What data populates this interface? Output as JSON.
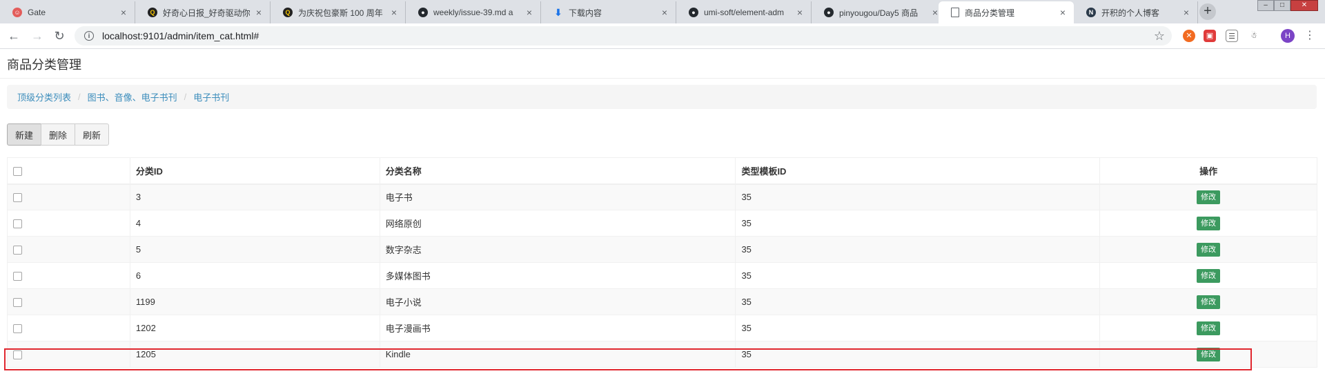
{
  "browser": {
    "tabs": [
      {
        "title": "Gate",
        "icon": "gate-favicon-icon",
        "color": "#e35d5b"
      },
      {
        "title": "好奇心日报_好奇驱动你",
        "icon": "q-favicon-icon",
        "color": "#222222"
      },
      {
        "title": "为庆祝包豪斯 100 周年",
        "icon": "q-favicon-icon",
        "color": "#222222"
      },
      {
        "title": "weekly/issue-39.md a",
        "icon": "github-icon",
        "color": "#24292e"
      },
      {
        "title": "下载内容",
        "icon": "download-icon",
        "color": "#1a73e8"
      },
      {
        "title": "umi-soft/element-adm",
        "icon": "github-icon",
        "color": "#24292e"
      },
      {
        "title": "pinyougou/Day5 商品",
        "icon": "github-icon",
        "color": "#24292e"
      },
      {
        "title": "商品分类管理",
        "icon": "page-icon",
        "color": "#5f6368"
      },
      {
        "title": "开积的个人博客",
        "icon": "n-favicon-icon",
        "color": "#2b3a4a"
      }
    ],
    "new_tab_symbol": "+",
    "address": "localhost:9101/admin/item_cat.html#",
    "profile_initial": "H"
  },
  "page": {
    "title": "商品分类管理",
    "breadcrumb": [
      "顶级分类列表",
      "图书、音像、电子书刊",
      "电子书刊"
    ],
    "buttons": {
      "new": "新建",
      "delete": "删除",
      "refresh": "刷新"
    },
    "table": {
      "headers": {
        "id": "分类ID",
        "name": "分类名称",
        "template": "类型模板ID",
        "op": "操作"
      },
      "rows": [
        {
          "id": "3",
          "name": "电子书",
          "template": "35",
          "op": "修改"
        },
        {
          "id": "4",
          "name": "网络原创",
          "template": "35",
          "op": "修改"
        },
        {
          "id": "5",
          "name": "数字杂志",
          "template": "35",
          "op": "修改"
        },
        {
          "id": "6",
          "name": "多媒体图书",
          "template": "35",
          "op": "修改"
        },
        {
          "id": "1199",
          "name": "电子小说",
          "template": "35",
          "op": "修改"
        },
        {
          "id": "1202",
          "name": "电子漫画书",
          "template": "35",
          "op": "修改"
        },
        {
          "id": "1205",
          "name": "Kindle",
          "template": "35",
          "op": "修改"
        }
      ]
    }
  },
  "colors": {
    "link": "#3c8dbc",
    "edit_button": "#3c9a5f",
    "highlight": "#e0262e"
  }
}
